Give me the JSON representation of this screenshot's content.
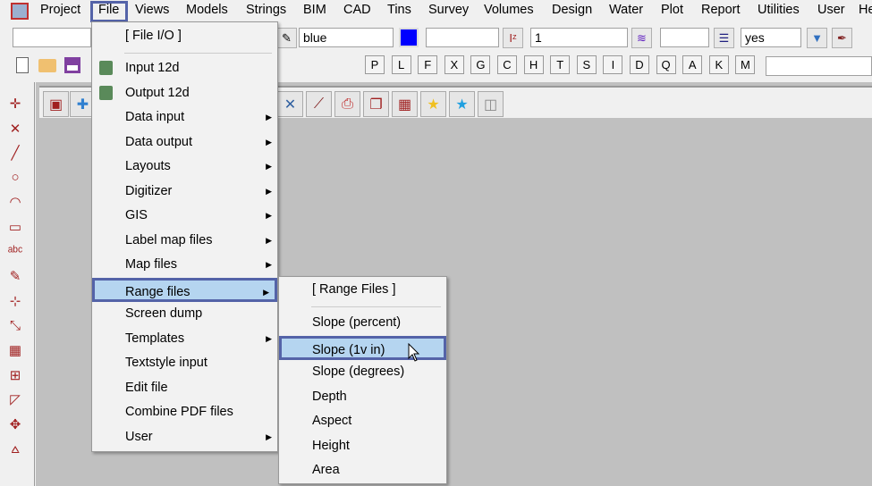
{
  "menubar": {
    "items": [
      "Project",
      "File",
      "Views",
      "Models",
      "Strings",
      "BIM",
      "CAD",
      "Tins",
      "Survey",
      "Volumes",
      "Design",
      "Water",
      "Plot",
      "Report",
      "Utilities",
      "User",
      "He"
    ]
  },
  "toolbar": {
    "colour_value": "blue",
    "colour_swatch": "#0000ff",
    "number_value": "1",
    "yes_value": "yes",
    "letters": [
      "P",
      "L",
      "F",
      "X",
      "G",
      "C",
      "H",
      "T",
      "S",
      "I",
      "D",
      "Q",
      "A",
      "K",
      "M"
    ]
  },
  "file_menu": {
    "header": "[ File I/O ]",
    "items": [
      {
        "label": "Input 12d",
        "submenu": false,
        "icon": "12d-box-icon"
      },
      {
        "label": "Output 12d",
        "submenu": false,
        "icon": "12d-box-icon"
      },
      {
        "label": "Data input",
        "submenu": true
      },
      {
        "label": "Data output",
        "submenu": true
      },
      {
        "label": "Layouts",
        "submenu": true
      },
      {
        "label": "Digitizer",
        "submenu": true
      },
      {
        "label": "GIS",
        "submenu": true
      },
      {
        "label": "Label map files",
        "submenu": true
      },
      {
        "label": "Map files",
        "submenu": true
      },
      {
        "label": "Range files",
        "submenu": true,
        "highlighted": true
      },
      {
        "label": "Screen dump",
        "submenu": false
      },
      {
        "label": "Templates",
        "submenu": true
      },
      {
        "label": "Textstyle input",
        "submenu": false
      },
      {
        "label": "Edit file",
        "submenu": false
      },
      {
        "label": "Combine PDF files",
        "submenu": false
      },
      {
        "label": "User",
        "submenu": true
      }
    ]
  },
  "range_menu": {
    "header": "[ Range Files ]",
    "items": [
      {
        "label": "Slope (percent)"
      },
      {
        "label": "Slope (1v in)",
        "highlighted": true
      },
      {
        "label": "Slope (degrees)"
      },
      {
        "label": "Depth"
      },
      {
        "label": "Aspect"
      },
      {
        "label": "Height"
      },
      {
        "label": "Area"
      }
    ]
  },
  "colors": {
    "highlight": "#b5d5f0",
    "focus_border": "#5463a8"
  }
}
